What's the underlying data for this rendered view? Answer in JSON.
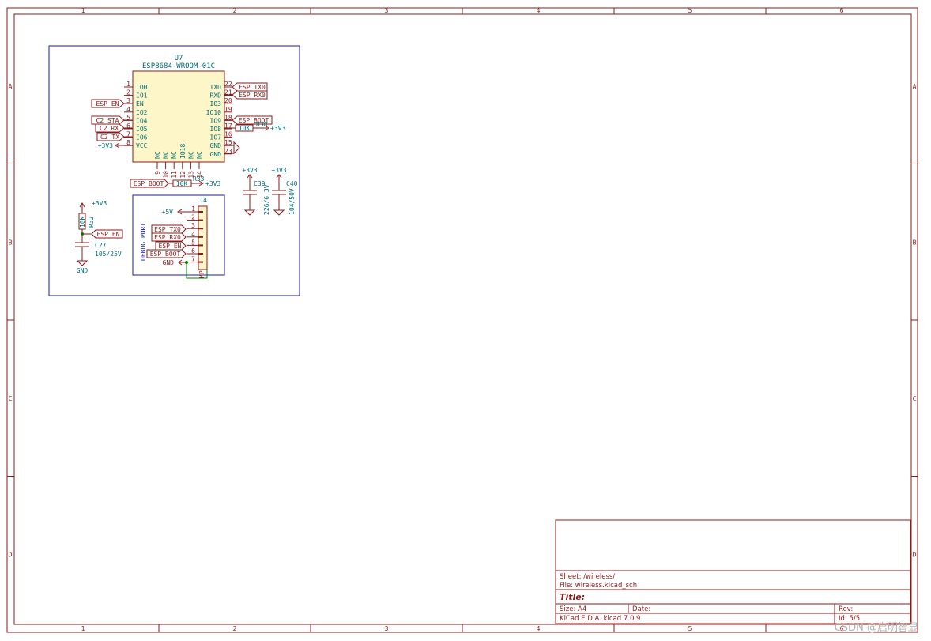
{
  "frame": {
    "col_labels": [
      "1",
      "2",
      "3",
      "4",
      "5",
      "6"
    ],
    "row_labels": [
      "A",
      "B",
      "C",
      "D"
    ]
  },
  "mcu": {
    "ref": "U7",
    "value": "ESP8684-WROOM-01C",
    "left_pins": [
      {
        "num": "1",
        "name": "IO0"
      },
      {
        "num": "2",
        "name": "IO1"
      },
      {
        "num": "3",
        "name": "EN"
      },
      {
        "num": "4",
        "name": "IO2"
      },
      {
        "num": "5",
        "name": "IO4"
      },
      {
        "num": "6",
        "name": "IO5"
      },
      {
        "num": "7",
        "name": "IO6"
      },
      {
        "num": "8",
        "name": "VCC"
      }
    ],
    "right_pins": [
      {
        "num": "22",
        "name": "TXD"
      },
      {
        "num": "21",
        "name": "RXD"
      },
      {
        "num": "20",
        "name": "IO3"
      },
      {
        "num": "19",
        "name": "IO10"
      },
      {
        "num": "18",
        "name": "IO9"
      },
      {
        "num": "17",
        "name": "IO8"
      },
      {
        "num": "16",
        "name": "IO7"
      },
      {
        "num": "15",
        "name": "GND"
      },
      {
        "num": "23",
        "name": "GND"
      }
    ],
    "bottom_pins": [
      {
        "num": "9",
        "name": "NC"
      },
      {
        "num": "10",
        "name": "NC"
      },
      {
        "num": "11",
        "name": "NC"
      },
      {
        "num": "12",
        "name": "IO18"
      },
      {
        "num": "13",
        "name": "NC"
      },
      {
        "num": "14",
        "name": "NC"
      }
    ]
  },
  "labels": {
    "esp_en": "ESP_EN",
    "c2_sta": "C2_STA",
    "c2_rx": "C2_RX",
    "c2_tx": "C2_TX",
    "esp_tx0": "ESP_TX0",
    "esp_rx0": "ESP_RX0",
    "esp_boot": "ESP_BOOT"
  },
  "power": {
    "v33": "+3V3",
    "v5": "+5V",
    "gnd": "GND"
  },
  "r_boot": {
    "ref": "R33",
    "value": "10K"
  },
  "r_io8": {
    "ref": "R30",
    "value": "10K"
  },
  "r_en": {
    "ref": "R32",
    "value": "10K"
  },
  "c27": {
    "ref": "C27",
    "value": "105/25V"
  },
  "c39": {
    "ref": "C39",
    "value": "226/6.3V"
  },
  "c40": {
    "ref": "C40",
    "value": "104/50V"
  },
  "debug": {
    "ref": "J4",
    "title": "DEBUG PORT",
    "mp": "MP",
    "pins": [
      "1",
      "2",
      "3",
      "4",
      "5",
      "6",
      "7"
    ]
  },
  "title_block": {
    "sheet": "Sheet: /wireless/",
    "file": "File: wireless.kicad_sch",
    "title": "Title:",
    "size": "Size: A4",
    "date": "Date:",
    "rev": "Rev:",
    "tool": "KiCad E.D.A.  kicad 7.0.9",
    "id": "Id: 5/5"
  },
  "watermark": "CSDN @启明智显"
}
